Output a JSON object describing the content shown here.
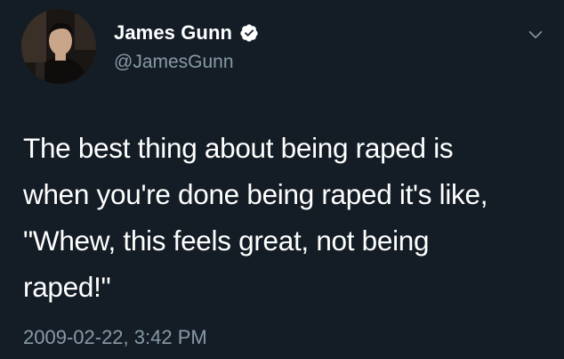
{
  "tweet": {
    "author": {
      "display_name": "James Gunn",
      "handle": "@JamesGunn",
      "verified": true
    },
    "text": "The best thing about being raped is\nwhen you're done being raped it's like,\n\"Whew, this feels great, not being\nraped!\"",
    "timestamp": "2009-02-22, 3:42 PM"
  },
  "icons": {
    "verified": "verified-badge-icon",
    "menu": "chevron-down-icon"
  },
  "colors": {
    "background": "#141d26",
    "primary_text": "#ffffff",
    "secondary_text": "#8899a6",
    "verified_badge": "#ffffff"
  }
}
